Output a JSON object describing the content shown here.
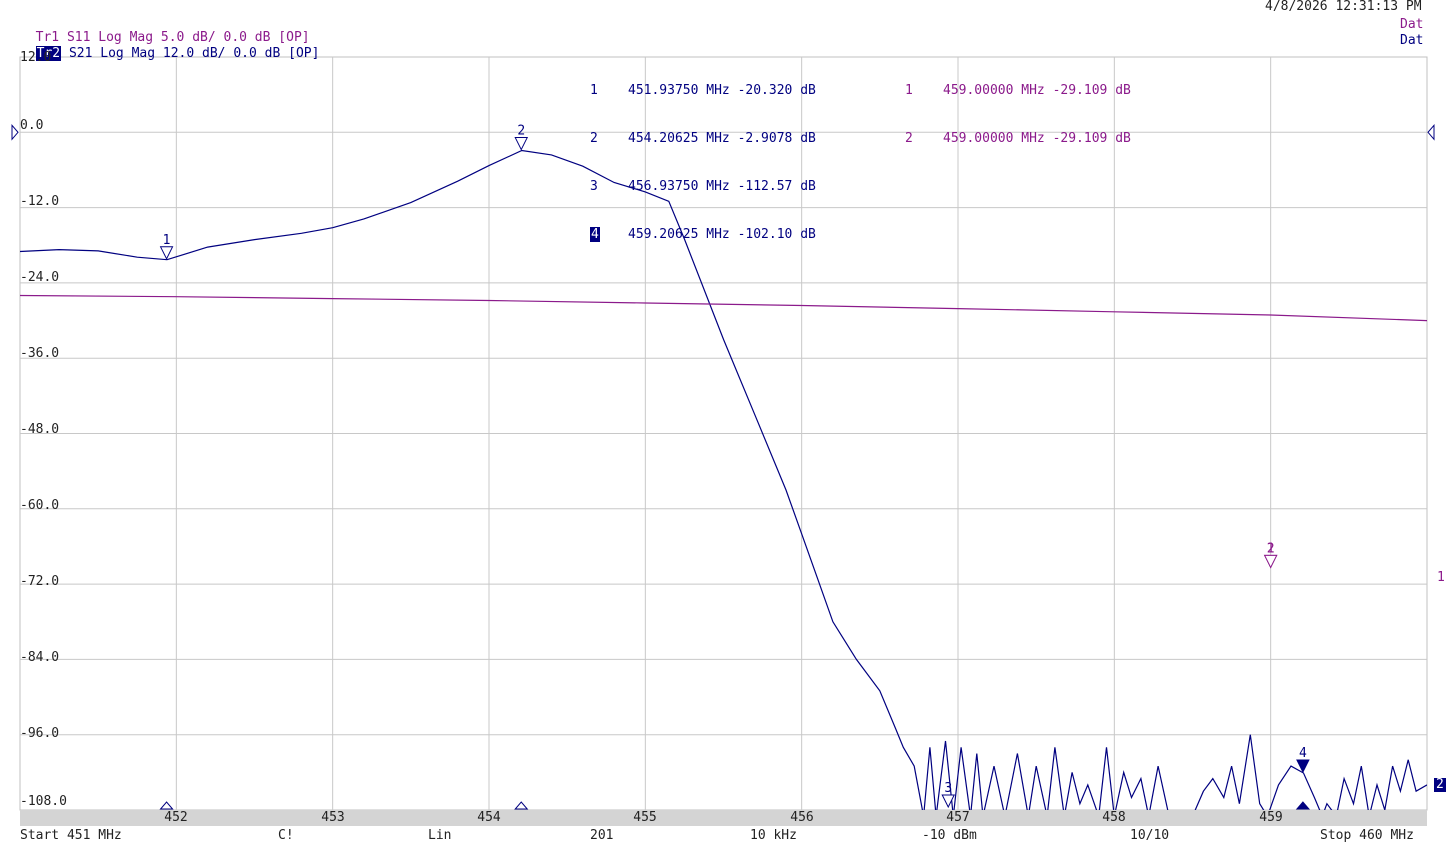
{
  "datetime": "4/8/2026 12:31:13 PM",
  "traces": [
    {
      "id": "Tr1",
      "label": "Tr1",
      "desc": "S11 Log Mag 5.0 dB/ 0.0 dB [OP]",
      "status": "Dat",
      "color": "#8b1a8b"
    },
    {
      "id": "Tr2",
      "label": "Tr2",
      "desc": "S21 Log Mag 12.0 dB/ 0.0 dB [OP]",
      "status": "Dat",
      "color": "#000080"
    }
  ],
  "markers_tr2": [
    {
      "num": "1",
      "freq": "451.93750 MHz",
      "val": "-20.320 dB"
    },
    {
      "num": "2",
      "freq": "454.20625 MHz",
      "val": "-2.9078 dB"
    },
    {
      "num": "3",
      "freq": "456.93750 MHz",
      "val": "-112.57 dB"
    },
    {
      "num": "4",
      "freq": "459.20625 MHz",
      "val": "-102.10 dB"
    }
  ],
  "markers_tr1": [
    {
      "num": "1",
      "freq": "459.00000 MHz",
      "val": "-29.109 dB"
    },
    {
      "num": "2",
      "freq": "459.00000 MHz",
      "val": "-29.109 dB"
    }
  ],
  "footer": {
    "start": "Start 451 MHz",
    "cal": "C!",
    "sweep": "Lin",
    "points": "201",
    "ifbw": "10 kHz",
    "power": "-10 dBm",
    "avg": "10/10",
    "stop": "Stop 460 MHz"
  },
  "ref_labels": {
    "tr1": "1",
    "tr2": "2"
  },
  "chart_data": {
    "type": "line",
    "x_unit": "MHz",
    "xlim": [
      451,
      460
    ],
    "ylim": [
      -108,
      12
    ],
    "y_ticks": [
      "12.0",
      "0.0",
      "-12.0",
      "-24.0",
      "-36.0",
      "-48.0",
      "-60.0",
      "-72.0",
      "-84.0",
      "-96.0",
      "-108.0"
    ],
    "x_ticks": [
      "452",
      "453",
      "454",
      "455",
      "456",
      "457",
      "458",
      "459"
    ],
    "grid": true,
    "series": [
      {
        "name": "S21",
        "color": "#000080",
        "scale": "12.0 dB/div",
        "ref": "0.0 dB",
        "points": [
          [
            451,
            -19
          ],
          [
            451.25,
            -18.7
          ],
          [
            451.5,
            -18.9
          ],
          [
            451.75,
            -19.9
          ],
          [
            451.94,
            -20.3
          ],
          [
            452.2,
            -18.3
          ],
          [
            452.5,
            -17.1
          ],
          [
            452.8,
            -16.1
          ],
          [
            453.0,
            -15.2
          ],
          [
            453.2,
            -13.8
          ],
          [
            453.5,
            -11.2
          ],
          [
            453.8,
            -7.8
          ],
          [
            454.0,
            -5.3
          ],
          [
            454.21,
            -2.9
          ],
          [
            454.4,
            -3.6
          ],
          [
            454.6,
            -5.4
          ],
          [
            454.8,
            -8.0
          ],
          [
            455.0,
            -9.5
          ],
          [
            455.15,
            -11.0
          ],
          [
            455.25,
            -17
          ],
          [
            455.5,
            -33
          ],
          [
            455.7,
            -45
          ],
          [
            455.9,
            -57
          ],
          [
            456.0,
            -64
          ],
          [
            456.1,
            -71
          ],
          [
            456.2,
            -78
          ],
          [
            456.35,
            -84
          ],
          [
            456.5,
            -89
          ],
          [
            456.6,
            -95
          ],
          [
            456.65,
            -98
          ],
          [
            456.72,
            -101
          ],
          [
            456.78,
            -109
          ],
          [
            456.82,
            -98
          ],
          [
            456.86,
            -109
          ],
          [
            456.92,
            -97
          ],
          [
            456.97,
            -109
          ],
          [
            457.02,
            -98
          ],
          [
            457.08,
            -109
          ],
          [
            457.12,
            -99
          ],
          [
            457.16,
            -109
          ],
          [
            457.23,
            -101
          ],
          [
            457.3,
            -109
          ],
          [
            457.38,
            -99
          ],
          [
            457.45,
            -109
          ],
          [
            457.5,
            -101
          ],
          [
            457.57,
            -109
          ],
          [
            457.62,
            -98
          ],
          [
            457.68,
            -109
          ],
          [
            457.73,
            -102
          ],
          [
            457.78,
            -107
          ],
          [
            457.83,
            -104
          ],
          [
            457.9,
            -109
          ],
          [
            457.95,
            -98
          ],
          [
            458.0,
            -109
          ],
          [
            458.06,
            -102
          ],
          [
            458.11,
            -106
          ],
          [
            458.17,
            -103
          ],
          [
            458.22,
            -109
          ],
          [
            458.28,
            -101
          ],
          [
            458.35,
            -109
          ],
          [
            458.5,
            -109
          ],
          [
            458.57,
            -105
          ],
          [
            458.63,
            -103
          ],
          [
            458.7,
            -106
          ],
          [
            458.75,
            -101
          ],
          [
            458.8,
            -107
          ],
          [
            458.87,
            -96
          ],
          [
            458.93,
            -107
          ],
          [
            458.98,
            -109
          ],
          [
            459.05,
            -104
          ],
          [
            459.13,
            -101
          ],
          [
            459.21,
            -102.1
          ],
          [
            459.28,
            -106
          ],
          [
            459.33,
            -109
          ],
          [
            459.36,
            -107
          ],
          [
            459.42,
            -109
          ],
          [
            459.47,
            -103
          ],
          [
            459.53,
            -107
          ],
          [
            459.58,
            -101
          ],
          [
            459.63,
            -109
          ],
          [
            459.68,
            -104
          ],
          [
            459.73,
            -108
          ],
          [
            459.78,
            -101
          ],
          [
            459.83,
            -105
          ],
          [
            459.88,
            -100
          ],
          [
            459.93,
            -105
          ],
          [
            460.0,
            -104
          ]
        ]
      },
      {
        "name": "S11",
        "color": "#8b1a8b",
        "scale": "5.0 dB/div",
        "ref": "0.0 dB",
        "points": [
          [
            451,
            -26.0
          ],
          [
            452,
            -26.2
          ],
          [
            453,
            -26.5
          ],
          [
            454,
            -26.8
          ],
          [
            455,
            -27.2
          ],
          [
            456,
            -27.6
          ],
          [
            457,
            -28.1
          ],
          [
            458,
            -28.6
          ],
          [
            459,
            -29.109
          ],
          [
            460,
            -30.0
          ]
        ]
      }
    ],
    "markers": [
      {
        "trace": "S21",
        "num": "1",
        "x": 451.9375,
        "y": -20.32
      },
      {
        "trace": "S21",
        "num": "2",
        "x": 454.20625,
        "y": -2.9078
      },
      {
        "trace": "S21",
        "num": "3",
        "x": 456.9375,
        "y": -112.57
      },
      {
        "trace": "S21",
        "num": "4",
        "x": 459.20625,
        "y": -102.1,
        "active": true
      },
      {
        "trace": "S11",
        "num": "1",
        "x": 459.0,
        "y": -29.109
      },
      {
        "trace": "S11",
        "num": "2",
        "x": 459.0,
        "y": -29.109
      }
    ]
  }
}
